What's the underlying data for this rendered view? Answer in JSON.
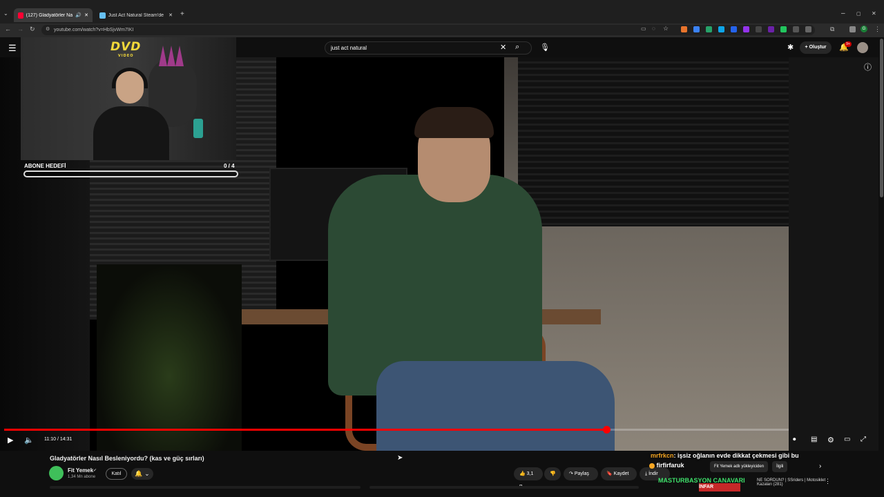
{
  "browser": {
    "tabs": [
      {
        "label": "(127) Gladyatörler Nasıl Be",
        "active": true,
        "favicon_color": "#ff0033"
      },
      {
        "label": "Just Act Natural Steam'de",
        "active": false,
        "favicon_color": "#1b2838"
      }
    ],
    "new_tab": "+",
    "url": "youtube.com/watch?v=HbSjvWm7IKI",
    "window_controls": [
      "–",
      "▢",
      "✕"
    ]
  },
  "youtube": {
    "search_query": "just act natural",
    "create_label": "Oluştur",
    "notification_count": "9+",
    "video": {
      "title": "Gladyatörler Nasıl Besleniyordu? (kas ve güç sırları)",
      "time": "11:10 / 14:31",
      "progress_fraction": 0.768
    },
    "channel": {
      "name": "Fit Yemek",
      "subscribers": "1,34 Mn abone",
      "join_label": "Katıl"
    },
    "actions": {
      "likes": "3,1 B",
      "share": "Paylaş",
      "save": "Kaydet",
      "download": "İndir"
    },
    "recs": {
      "chip1": "Fit Yemek adlı yükleyiciden",
      "chip2": "İlgili",
      "title": "NE SORDUN? | SSriders | Motosiklet Kazaları (281)"
    }
  },
  "stream_overlay": {
    "dvd_logo": "DVD",
    "dvd_sub": "VIDEO",
    "goal_label": "ABONE HEDEFİ",
    "goal_count": "0 / 4",
    "goal_fraction": 0,
    "chat": [
      {
        "user": "mrfrkcn",
        "text": ": işsiz oğlanın evde dikkat çekmesi gibi bu"
      },
      {
        "user": "firfirfaruk",
        "text": ""
      },
      {
        "user": "",
        "text": "MASTURBASYON CANAVARI"
      }
    ],
    "red_chip": "İNFAR"
  },
  "icons": {
    "menu": "hamburger-icon",
    "search": "search-icon",
    "mic": "mic-icon",
    "bell": "bell-icon"
  }
}
